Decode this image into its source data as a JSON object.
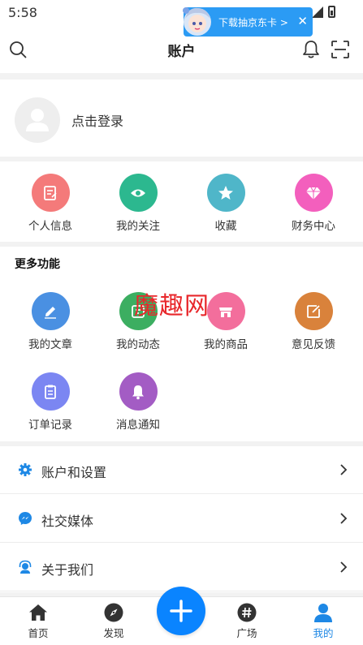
{
  "status_bar": {
    "time": "5:58"
  },
  "promo": {
    "text": "下载抽京东卡 >",
    "close": "✕"
  },
  "header": {
    "title": "账户"
  },
  "login": {
    "text": "点击登录"
  },
  "quick_items": [
    {
      "label": "个人信息",
      "icon": "id-card-icon",
      "color": "#f47a7a"
    },
    {
      "label": "我的关注",
      "icon": "eye-icon",
      "color": "#2cb88f"
    },
    {
      "label": "收藏",
      "icon": "star-icon",
      "color": "#4fb6c9"
    },
    {
      "label": "财务中心",
      "icon": "diamond-icon",
      "color": "#f35fbd"
    }
  ],
  "more": {
    "title": "更多功能",
    "items": [
      {
        "label": "我的文章",
        "icon": "pencil-icon",
        "color": "#4a90e2"
      },
      {
        "label": "我的动态",
        "icon": "activity-icon",
        "color": "#3cae61"
      },
      {
        "label": "我的商品",
        "icon": "shop-icon",
        "color": "#f36e9c"
      },
      {
        "label": "意见反馈",
        "icon": "edit-icon",
        "color": "#d9823b"
      },
      {
        "label": "订单记录",
        "icon": "clipboard-icon",
        "color": "#7b86f2"
      },
      {
        "label": "消息通知",
        "icon": "bell-icon",
        "color": "#a35cc4"
      }
    ]
  },
  "watermark": "魔趣网",
  "list": [
    {
      "label": "账户和设置",
      "icon": "gear-icon"
    },
    {
      "label": "社交媒体",
      "icon": "messenger-icon"
    },
    {
      "label": "关于我们",
      "icon": "support-icon"
    }
  ],
  "nav": [
    {
      "label": "首页",
      "icon": "home-icon"
    },
    {
      "label": "发现",
      "icon": "compass-icon"
    },
    {
      "label": "广场",
      "icon": "hashtag-icon"
    },
    {
      "label": "我的",
      "icon": "user-icon"
    }
  ],
  "colors": {
    "accent": "#1e88e5",
    "fab": "#0a84ff"
  }
}
